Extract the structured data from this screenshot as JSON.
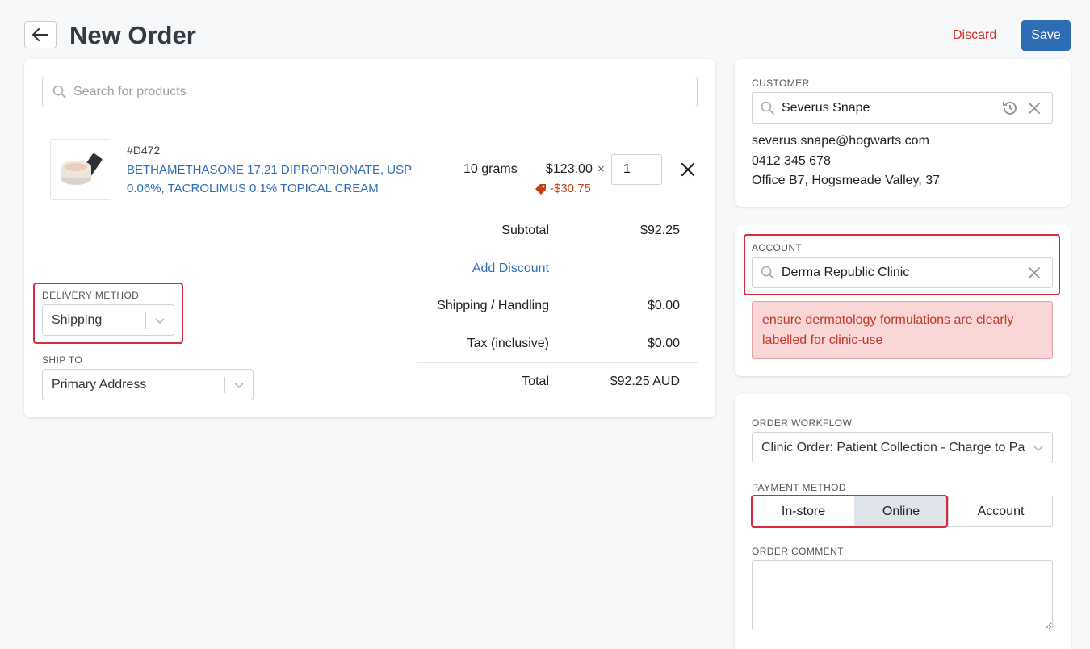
{
  "header": {
    "title": "New Order",
    "discard_label": "Discard",
    "save_label": "Save"
  },
  "product_search": {
    "placeholder": "Search for products"
  },
  "line_item": {
    "sku": "#D472",
    "name": "BETHAMETHASONE 17,21 DIPROPRIONATE, USP 0.06%, TACROLIMUS 0.1% TOPICAL CREAM",
    "variant": "10 grams",
    "price": "$123.00",
    "times": "×",
    "discount": "-$30.75",
    "quantity": "1"
  },
  "totals": {
    "subtotal_label": "Subtotal",
    "subtotal_value": "$92.25",
    "add_discount_label": "Add Discount",
    "shipping_label": "Shipping / Handling",
    "shipping_value": "$0.00",
    "tax_label": "Tax (inclusive)",
    "tax_value": "$0.00",
    "total_label": "Total",
    "total_value": "$92.25 AUD"
  },
  "delivery": {
    "label": "DELIVERY METHOD",
    "value": "Shipping"
  },
  "ship_to": {
    "label": "SHIP TO",
    "value": "Primary Address"
  },
  "customer": {
    "label": "CUSTOMER",
    "name": "Severus Snape",
    "email": "severus.snape@hogwarts.com",
    "phone": "0412 345 678",
    "address": "Office B7, Hogsmeade Valley, 37"
  },
  "account": {
    "label": "ACCOUNT",
    "name": "Derma Republic Clinic",
    "warning": "ensure dermatology formulations are clearly labelled for clinic-use"
  },
  "order_workflow": {
    "label": "ORDER WORKFLOW",
    "value": "Clinic Order: Patient Collection - Charge to Pa"
  },
  "payment_method": {
    "label": "PAYMENT METHOD",
    "options": [
      "In-store",
      "Online",
      "Account"
    ],
    "selected": "Online"
  },
  "order_comment": {
    "label": "ORDER COMMENT",
    "value": ""
  },
  "colors": {
    "primary": "#2e6db4",
    "danger": "#d0302a",
    "highlight_border": "#d62a3a",
    "warning_bg": "#fbd6d7",
    "selected_segment_bg": "#dfe3ea"
  }
}
